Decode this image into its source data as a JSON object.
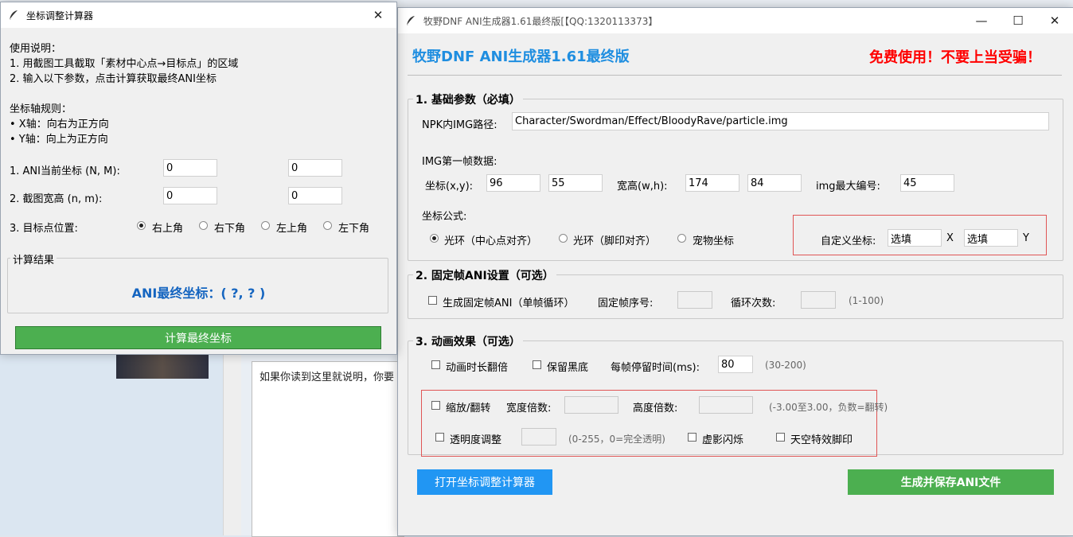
{
  "background_window": {
    "textbox_text": "如果你读到这里就说明，你要"
  },
  "calc": {
    "title": "坐标调整计算器",
    "usage_title": "使用说明：",
    "usage_1": "1. 用截图工具截取「素材中心点→目标点」的区域",
    "usage_2": "2. 输入以下参数，点击计算获取最终ANI坐标",
    "axis_title": "坐标轴规则：",
    "axis_x": "• X轴：向右为正方向",
    "axis_y": "• Y轴：向上为正方向",
    "ani_coord_label": "1. ANI当前坐标 (N, M):",
    "ani_n": "0",
    "ani_m": "0",
    "shot_size_label": "2. 截图宽高 (n, m):",
    "shot_n": "0",
    "shot_m": "0",
    "target_label": "3. 目标点位置:",
    "target_options": [
      "右上角",
      "右下角",
      "左上角",
      "左下角"
    ],
    "selected_target": "右上角",
    "result_group": "计算结果",
    "result_text": "ANI最终坐标：( ?, ? )",
    "calc_button": "计算最终坐标"
  },
  "main": {
    "window_title": "牧野DNF ANI生成器1.61最终版[【QQ:1320113373】",
    "heading": "牧野DNF ANI生成器1.61最终版",
    "warning": "免费使用！不要上当受骗！",
    "basic": {
      "group": "1. 基础参数（必填）",
      "npk_label": "NPK内IMG路径:",
      "npk_value": "Character/Swordman/Effect/BloodyRave/particle.img",
      "first_frame_label": "IMG第一帧数据:",
      "xy_label": "坐标(x,y):",
      "x": "96",
      "y": "55",
      "wh_label": "宽高(w,h):",
      "w": "174",
      "h": "84",
      "max_label": "img最大编号:",
      "max_value": "45",
      "formula_label": "坐标公式:",
      "formula_options": [
        "光环（中心点对齐）",
        "光环（脚印对齐）",
        "宠物坐标"
      ],
      "custom_label": "自定义坐标:",
      "custom_x": "选填",
      "custom_x_suffix": "X",
      "custom_y": "选填",
      "custom_y_suffix": "Y"
    },
    "fixed": {
      "group": "2. 固定帧ANI设置（可选）",
      "gen_fixed": "生成固定帧ANI（单帧循环）",
      "frame_no_label": "固定帧序号:",
      "loop_label": "循环次数:",
      "loop_hint": "(1-100)"
    },
    "anim": {
      "group": "3. 动画效果（可选）",
      "double_duration": "动画时长翻倍",
      "keep_black": "保留黑底",
      "delay_label": "每帧停留时间(ms):",
      "delay_value": "80",
      "delay_hint": "(30-200)",
      "scale_flip": "缩放/翻转",
      "width_ratio_label": "宽度倍数:",
      "height_ratio_label": "高度倍数:",
      "ratio_hint": "(-3.00至3.00，负数=翻转)",
      "alpha": "透明度调整",
      "alpha_hint": "(0-255，0=完全透明)",
      "ghost": "虚影闪烁",
      "sky": "天空特效脚印"
    },
    "open_calc_button": "打开坐标调整计算器",
    "save_button": "生成并保存ANI文件",
    "colors": {
      "heading": "#1f8ee0",
      "warning": "#ff0000",
      "blue_button": "#2196f3",
      "green_button": "#4caf50",
      "result": "#1565c0"
    }
  }
}
